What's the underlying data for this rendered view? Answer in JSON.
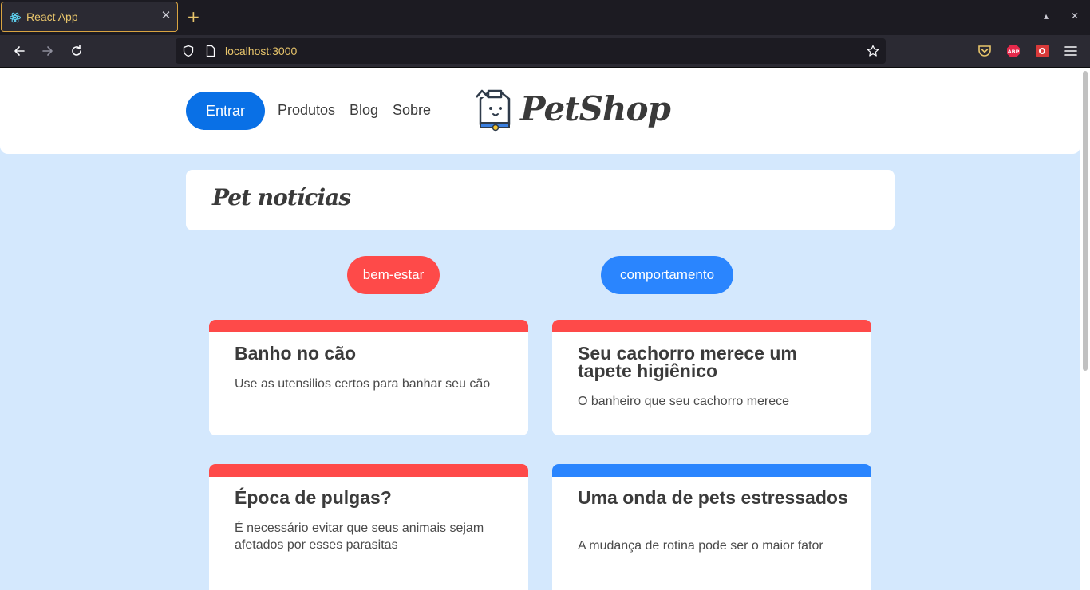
{
  "browser": {
    "tab_title": "React App",
    "url": "localhost:3000",
    "tab_close": "✕",
    "new_tab": "+",
    "minimize": "—",
    "maximize": "▴",
    "close": "✕"
  },
  "header": {
    "entrar_label": "Entrar",
    "menu": [
      "Produtos",
      "Blog",
      "Sobre"
    ],
    "logo_text": "PetShop"
  },
  "page_title": "Pet notícias",
  "categories": [
    {
      "label": "bem-estar",
      "color": "#fe4a49"
    },
    {
      "label": "comportamento",
      "color": "#2a85fe"
    }
  ],
  "posts": [
    {
      "title": "Banho no cão",
      "description": "Use as utensilios certos para banhar seu cão",
      "color": "#fe4a49"
    },
    {
      "title": "Seu cachorro merece um tapete higiênico",
      "description": "O banheiro que seu cachorro merece",
      "color": "#fe4a49"
    },
    {
      "title": "Época de pulgas?",
      "description": "É necessário evitar que seus animais sejam afetados por esses parasitas",
      "color": "#fe4a49"
    },
    {
      "title": "Uma onda de pets estressados",
      "description": "A mudança de rotina pode ser o maior fator",
      "color": "#2a85fe"
    }
  ],
  "colors": {
    "background": "#d4e8fd",
    "primary": "#0970e6",
    "bem_estar": "#fe4a49",
    "comportamento": "#2a85fe"
  }
}
